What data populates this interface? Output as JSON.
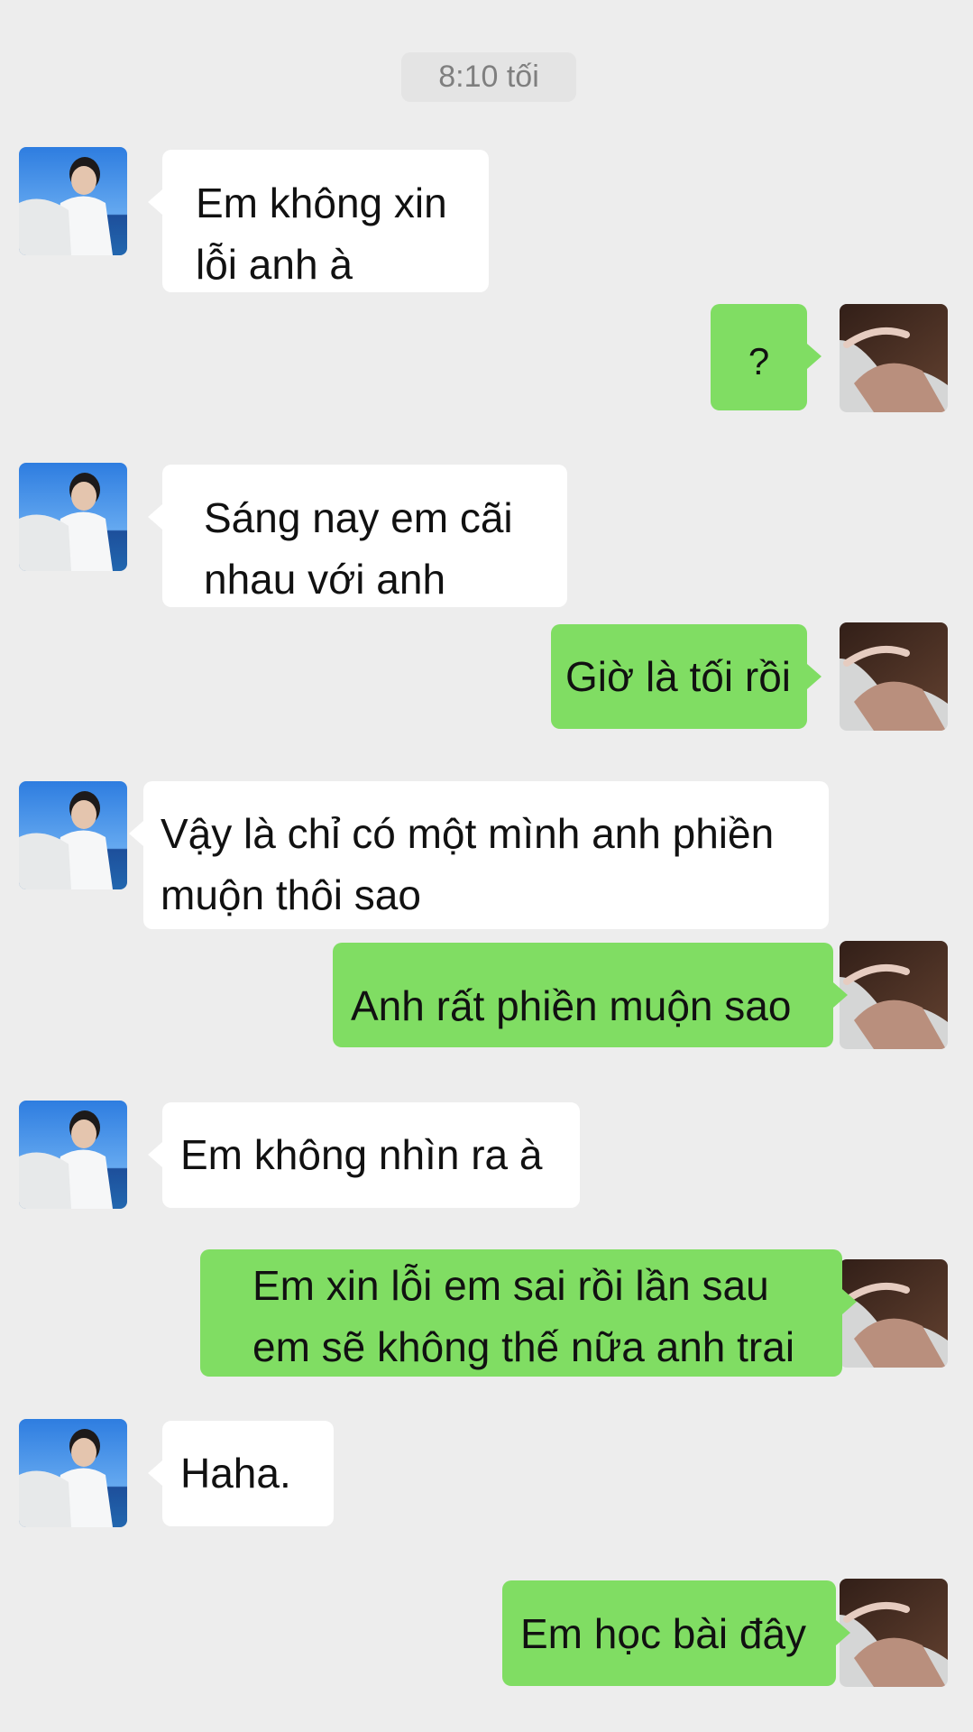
{
  "chat": {
    "timestamp": "8:10 tối",
    "messages": [
      {
        "side": "in",
        "text": "Em không xin\nlỗi anh à"
      },
      {
        "side": "out",
        "text": "?"
      },
      {
        "side": "in",
        "text": "Sáng nay em cãi\nnhau với anh"
      },
      {
        "side": "out",
        "text": "Giờ là tối rồi"
      },
      {
        "side": "in",
        "text": "Vậy là chỉ có một mình anh phiền\nmuộn thôi sao"
      },
      {
        "side": "out",
        "text": "Anh rất phiền muộn sao"
      },
      {
        "side": "in",
        "text": "Em không nhìn ra à"
      },
      {
        "side": "out",
        "text": "Em xin lỗi em sai rồi lần sau\nem sẽ không thế nữa anh trai"
      },
      {
        "side": "in",
        "text": "Haha."
      },
      {
        "side": "out",
        "text": "Em học bài đây"
      }
    ]
  },
  "avatars": {
    "contact": "contact-avatar",
    "self": "self-avatar"
  },
  "colors": {
    "background": "#EDEDED",
    "outgoing_bubble": "#80DD63",
    "incoming_bubble": "#FFFFFF",
    "timestamp_text": "#7F7F7F"
  }
}
